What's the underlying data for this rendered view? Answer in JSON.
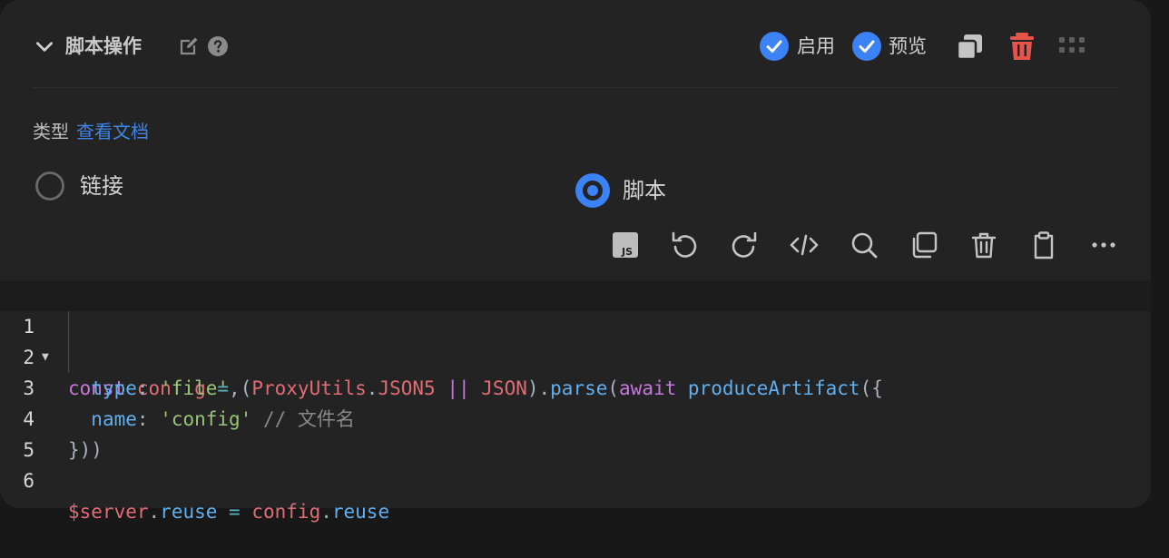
{
  "header": {
    "title": "脚本操作",
    "enable_label": "启用",
    "preview_label": "预览",
    "accent": "#3b82f6",
    "delete_color": "#e5534b"
  },
  "type_row": {
    "label": "类型",
    "doc_link": "查看文档"
  },
  "radios": [
    {
      "label": "链接",
      "selected": false
    },
    {
      "label": "脚本",
      "selected": true
    }
  ],
  "toolbar": {
    "js_badge": "JS",
    "icons": [
      "js-icon",
      "undo-icon",
      "redo-icon",
      "code-icon",
      "search-icon",
      "copy-icon",
      "trash-icon",
      "clipboard-icon",
      "more-icon"
    ]
  },
  "editor": {
    "line_numbers": [
      "1",
      "2",
      "3",
      "4",
      "5",
      "6"
    ],
    "lines": [
      "const config = (ProxyUtils.JSON5 || JSON).parse(await produceArtifact({",
      "  type: 'file',",
      "  name: 'config' // 文件名",
      "}))",
      "",
      "$server.reuse = config.reuse"
    ]
  }
}
